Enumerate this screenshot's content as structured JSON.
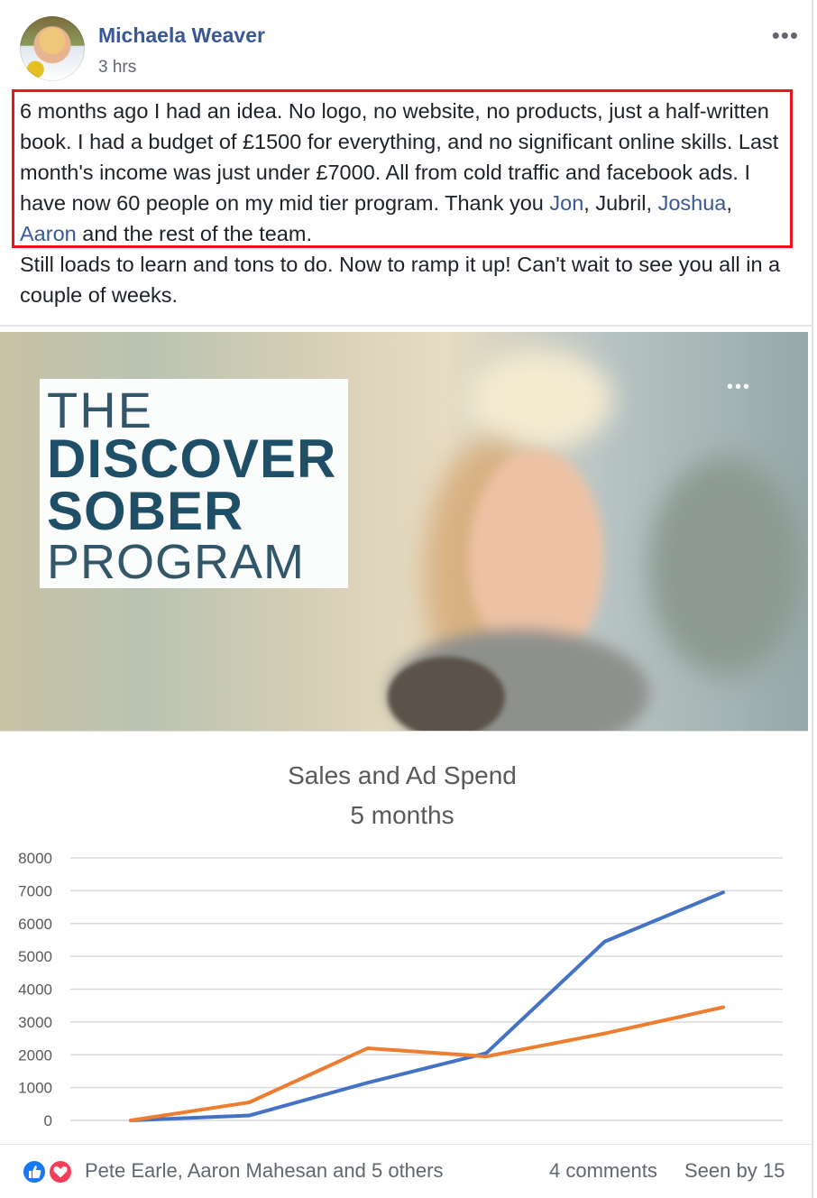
{
  "post": {
    "author": "Michaela Weaver",
    "time": "3 hrs",
    "more_icon": "more-horizontal-icon",
    "text": {
      "p1_a": "6 months ago I had an idea. No logo, no website, no products, just a half-written book. I had a budget of £1500 for everything, and no significant online skills. Last month's income was just under £7000. All from cold traffic and facebook ads. I have now 60 people on my mid tier program. Thank you ",
      "mention1": "Jon",
      "sep1": ", Jubril, ",
      "mention2": "Joshua",
      "sep2": ", ",
      "mention3": "Aaron",
      "p1_b": " and the rest of the team.",
      "p2": "Still loads to learn and tons to do. Now to ramp it up! Can't wait to see you all in a couple of weeks."
    },
    "highlight_color": "#e8161d",
    "link_color": "#385898"
  },
  "media": {
    "logo": {
      "line1": "THE",
      "line2": "DISCOVER",
      "line3": "SOBER",
      "line4": "PROGRAM"
    },
    "image_more_icon": "more-horizontal-icon"
  },
  "chart_data": {
    "type": "line",
    "title": "Sales and Ad Spend",
    "subtitle": "5 months",
    "xlabel": "",
    "ylabel": "",
    "ylim": [
      0,
      8000
    ],
    "yticks": [
      "8000",
      "7000",
      "6000",
      "5000",
      "4000",
      "3000",
      "2000",
      "1000",
      "0"
    ],
    "grid": true,
    "series": [
      {
        "color": "#4472c4",
        "values": [
          0,
          150,
          1150,
          2050,
          5450,
          6950
        ]
      },
      {
        "color": "#ed7d31",
        "values": [
          0,
          550,
          2200,
          1950,
          2650,
          3450
        ]
      }
    ]
  },
  "footer": {
    "reactions": [
      "like-icon",
      "love-icon"
    ],
    "reactors": "Pete Earle, Aaron Mahesan and 5 others",
    "comments": "4 comments",
    "seen": "Seen by 15"
  }
}
